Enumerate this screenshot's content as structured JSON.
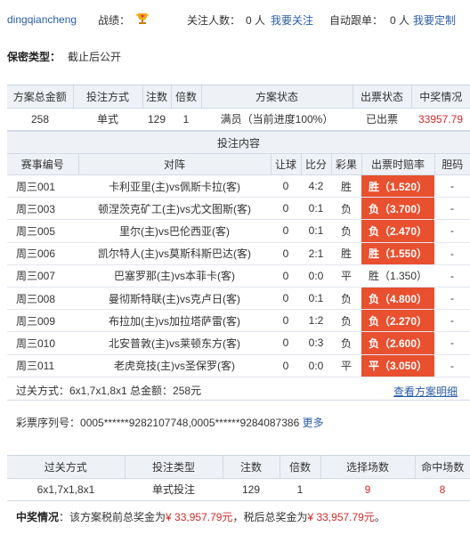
{
  "header": {
    "username": "dingqiancheng",
    "record_label": "战绩：",
    "trophy_icon": "trophy-icon",
    "follow_label": "关注人数：",
    "follow_count": "0 人",
    "follow_link": "我要关注",
    "auto_label": "自动跟单：",
    "auto_count": "0 人",
    "auto_link": "我要定制"
  },
  "secrecy": {
    "label": "保密类型：",
    "value": "截止后公开"
  },
  "summary": {
    "headers": [
      "方案总金额",
      "投注方式",
      "注数",
      "倍数",
      "方案状态",
      "出票状态",
      "中奖情况"
    ],
    "row": [
      "258",
      "单式",
      "129",
      "1",
      "满员（当前进度100%）",
      "已出票",
      "33957.79"
    ]
  },
  "content_title": "投注内容",
  "matches": {
    "headers": [
      "赛事编号",
      "对阵",
      "让球",
      "比分",
      "彩果",
      "出票时赔率",
      "胆码"
    ],
    "rows": [
      {
        "id": "周三001",
        "match": "卡利亚里(主)vs佩斯卡拉(客)",
        "handicap": "0",
        "score": "4:2",
        "result": "胜",
        "odds": "胜（1.520）",
        "hit": true,
        "banker": "-"
      },
      {
        "id": "周三003",
        "match": "顿涅茨克矿工(主)vs尤文图斯(客)",
        "handicap": "0",
        "score": "0:1",
        "result": "负",
        "odds": "负（3.700）",
        "hit": true,
        "banker": "-"
      },
      {
        "id": "周三005",
        "match": "里尔(主)vs巴伦西亚(客)",
        "handicap": "0",
        "score": "0:1",
        "result": "负",
        "odds": "负（2.470）",
        "hit": true,
        "banker": "-"
      },
      {
        "id": "周三006",
        "match": "凯尔特人(主)vs莫斯科斯巴达(客)",
        "handicap": "0",
        "score": "2:1",
        "result": "胜",
        "odds": "胜（1.550）",
        "hit": true,
        "banker": "-"
      },
      {
        "id": "周三007",
        "match": "巴塞罗那(主)vs本菲卡(客)",
        "handicap": "0",
        "score": "0:0",
        "result": "平",
        "odds": "胜（1.350）",
        "hit": false,
        "banker": "-"
      },
      {
        "id": "周三008",
        "match": "曼彻斯特联(主)vs克卢日(客)",
        "handicap": "0",
        "score": "0:1",
        "result": "负",
        "odds": "负（4.800）",
        "hit": true,
        "banker": "-"
      },
      {
        "id": "周三009",
        "match": "布拉加(主)vs加拉塔萨雷(客)",
        "handicap": "0",
        "score": "1:2",
        "result": "负",
        "odds": "负（2.270）",
        "hit": true,
        "banker": "-"
      },
      {
        "id": "周三010",
        "match": "北安普敦(主)vs莱顿东方(客)",
        "handicap": "0",
        "score": "0:3",
        "result": "负",
        "odds": "负（2.600）",
        "hit": true,
        "banker": "-"
      },
      {
        "id": "周三011",
        "match": "老虎竞技(主)vs圣保罗(客)",
        "handicap": "0",
        "score": "0:0",
        "result": "平",
        "odds": "平（3.050）",
        "hit": true,
        "banker": "-"
      }
    ]
  },
  "footer": {
    "pass_text": "过关方式：6x1,7x1,8x1 总金额：258元",
    "detail_link": "查看方案明细"
  },
  "serial": {
    "label": "彩票序列号：",
    "value": "0005******9282107748,0005******9284087386",
    "more": "更多"
  },
  "bottom": {
    "headers": [
      "过关方式",
      "投注类型",
      "注数",
      "倍数",
      "选择场数",
      "命中场数"
    ],
    "row": [
      "6x1,7x1,8x1",
      "单式投注",
      "129",
      "1",
      "9",
      "8"
    ]
  },
  "prize": {
    "label": "中奖情况",
    "text1": "：该方案税前总奖金为",
    "amount1": "¥ 33,957.79元",
    "text2": "，税后总奖金为",
    "amount2": "¥ 33,957.79元",
    "text3": "。"
  },
  "colors": {
    "hit_bg": "#e8502f",
    "link": "#2a5da8",
    "prize_red": "#d12a2a",
    "header_bg": "#eef1f6"
  }
}
